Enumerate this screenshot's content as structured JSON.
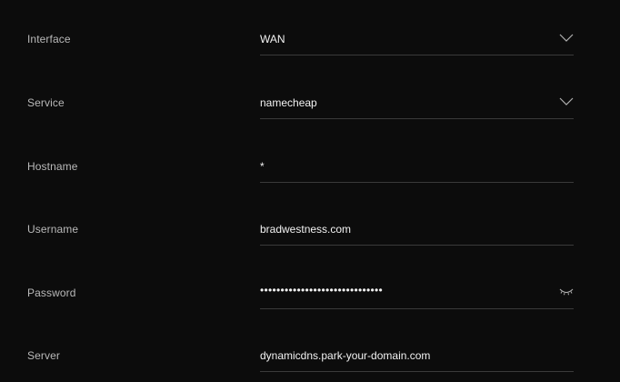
{
  "form": {
    "interface": {
      "label": "Interface",
      "value": "WAN",
      "icon": "chevron-down-icon"
    },
    "service": {
      "label": "Service",
      "value": "namecheap",
      "icon": "chevron-down-icon"
    },
    "hostname": {
      "label": "Hostname",
      "value": "*"
    },
    "username": {
      "label": "Username",
      "value": "bradwestness.com"
    },
    "password": {
      "label": "Password",
      "value": "••••••••••••••••••••••••••••••",
      "icon": "eye-closed-icon"
    },
    "server": {
      "label": "Server",
      "value": "dynamicdns.park-your-domain.com"
    }
  },
  "colors": {
    "background": "#0c0c0c",
    "label": "#b9b9b9",
    "value": "#f2f2f2",
    "underline": "#3a3a3a",
    "icon": "#b0b0b0"
  }
}
